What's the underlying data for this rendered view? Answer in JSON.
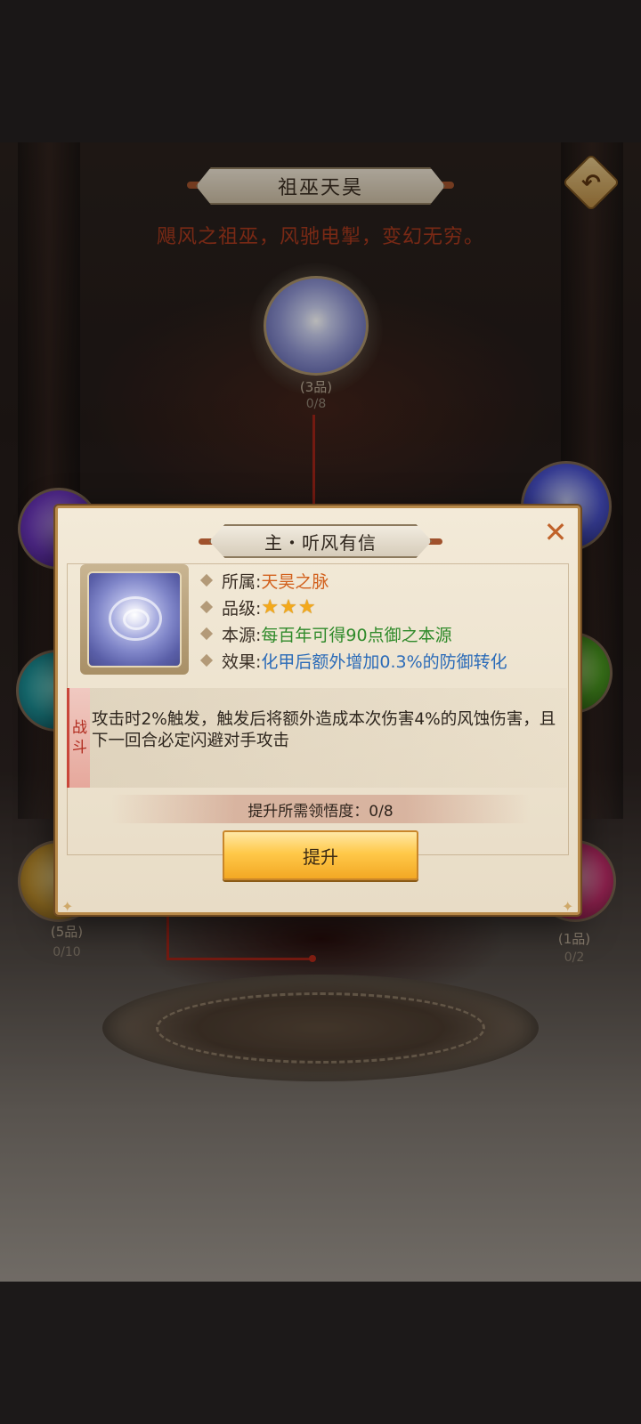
{
  "header": {
    "title": "祖巫天昊",
    "subtitle": "飓风之祖巫，风驰电掣，变幻无穷。"
  },
  "top_node": {
    "grade": "(3品)",
    "progress": "0/8"
  },
  "side_nodes": {
    "left_bottom": {
      "grade": "(5品)",
      "progress": "0/10"
    },
    "right_bottom": {
      "grade": "(1品)",
      "progress": "0/2"
    }
  },
  "modal": {
    "title": "主・听风有信",
    "close_glyph": "✕",
    "attributes": {
      "belong_key": "所属:",
      "belong_val": "天昊之脉",
      "grade_key": "品级:",
      "grade_stars": 3,
      "source_key": "本源:",
      "source_val": "每百年可得90点御之本源",
      "effect_key": "效果:",
      "effect_val": "化甲后额外增加0.3%的防御转化"
    },
    "battle_tag_1": "战",
    "battle_tag_2": "斗",
    "description": "攻击时2%触发，触发后将额外造成本次伤害4%的风蚀伤害，且下一回合必定闪避对手攻击",
    "requirement": "提升所需领悟度：0/8",
    "upgrade_label": "提升"
  },
  "colors": {
    "accent_orange": "#d2601c",
    "accent_green": "#2f8a2a",
    "accent_blue": "#2b6bb8",
    "subtitle_red": "#a8391e",
    "button_gold": "#ffc94a"
  },
  "icons": {
    "back": "back-arrow-icon",
    "close": "close-icon",
    "star": "star-icon"
  }
}
